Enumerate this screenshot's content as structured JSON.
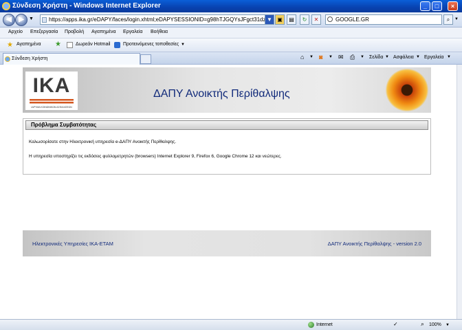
{
  "window": {
    "title": "Σύνδεση Χρήστη - Windows Internet Explorer"
  },
  "address": {
    "url": "https://apps.ika.gr/eDAPY/faces/login.xhtml;eDAPYSESSIONID=g98hTJGQYsJFgct31dzjYHHBMIY6",
    "search_value": "GOOGLE.GR"
  },
  "menu": {
    "items": [
      "Αρχείο",
      "Επεξεργασία",
      "Προβολή",
      "Αγαπημένα",
      "Εργαλεία",
      "Βοήθεια"
    ]
  },
  "favorites": {
    "favorites_label": "Αγαπημένα",
    "hotmail": "Δωρεάν Hotmail",
    "suggested": "Προτεινόμενες τοποθεσίες"
  },
  "tab": {
    "label": "Σύνδεση Χρήστη"
  },
  "commandbar": {
    "page": "Σελίδα",
    "safety": "Ασφάλεια",
    "tools": "Εργαλεία"
  },
  "page": {
    "header_title": "ΔΑΠΥ Ανοικτής Περίθαλψης",
    "logo_text": "ΙΚΑ",
    "logo_subtitle": "ΙΔΡΥΜΑ ΚΟΙΝΩΝΙΚΩΝ ΑΣΦΑΛΙΣΕΩΝ",
    "panel_title": "Πρόβλημα Συμβατότητας",
    "panel_line1": "Καλωσορίσατε στην Ηλεκτρονική υπηρεσία e-ΔΑΠΥ Ανοικτής Περίθαλψης.",
    "panel_line2": "Η υπηρεσία υποστηρίζει τις εκδόσεις φυλλομετρητών (browsers) Internet Explorer 9, Firefox 6, Google Chrome 12 και νεώτερες.",
    "footer_left": "Ηλεκτρονικές Υπηρεσίες ΙΚΑ-ΕΤΑΜ",
    "footer_right": "ΔΑΠΥ Ανοικτής Περίθαλψης - version 2.0"
  },
  "status": {
    "zone": "Internet",
    "zoom": "100%"
  },
  "colors": {
    "title_blue": "#112a7a",
    "logo_orange": "#d4571f"
  }
}
